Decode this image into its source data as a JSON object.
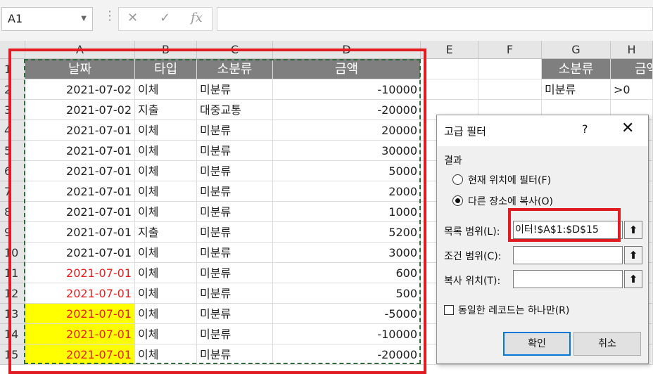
{
  "formula_bar": {
    "name_box": "A1",
    "cancel_icon": "✕",
    "enter_icon": "✓",
    "fx_label": "fx",
    "formula": ""
  },
  "columns": [
    "A",
    "B",
    "C",
    "D",
    "E",
    "F",
    "G",
    "H"
  ],
  "rows": [
    {
      "n": "1",
      "a": "날짜",
      "b": "타입",
      "c": "소분류",
      "d": "금액"
    },
    {
      "n": "2",
      "a": "2021-07-02",
      "b": "이체",
      "c": "미분류",
      "d": "-10000"
    },
    {
      "n": "3",
      "a": "2021-07-02",
      "b": "지출",
      "c": "대중교통",
      "d": "-20000"
    },
    {
      "n": "4",
      "a": "2021-07-01",
      "b": "이체",
      "c": "미분류",
      "d": "20000"
    },
    {
      "n": "5",
      "a": "2021-07-01",
      "b": "이체",
      "c": "미분류",
      "d": "30000"
    },
    {
      "n": "6",
      "a": "2021-07-01",
      "b": "이체",
      "c": "미분류",
      "d": "5000"
    },
    {
      "n": "7",
      "a": "2021-07-01",
      "b": "이체",
      "c": "미분류",
      "d": "2000"
    },
    {
      "n": "8",
      "a": "2021-07-01",
      "b": "이체",
      "c": "미분류",
      "d": "1000"
    },
    {
      "n": "9",
      "a": "2021-07-01",
      "b": "지출",
      "c": "미분류",
      "d": "5200"
    },
    {
      "n": "10",
      "a": "2021-07-01",
      "b": "이체",
      "c": "미분류",
      "d": "3000"
    },
    {
      "n": "11",
      "a": "2021-07-01",
      "b": "이체",
      "c": "미분류",
      "d": "600"
    },
    {
      "n": "12",
      "a": "2021-07-01",
      "b": "이체",
      "c": "미분류",
      "d": "500"
    },
    {
      "n": "13",
      "a": "2021-07-01",
      "b": "이체",
      "c": "미분류",
      "d": "-5000"
    },
    {
      "n": "14",
      "a": "2021-07-01",
      "b": "이체",
      "c": "미분류",
      "d": "-10000"
    },
    {
      "n": "15",
      "a": "2021-07-01",
      "b": "이체",
      "c": "미분류",
      "d": "-20000"
    }
  ],
  "criteria": {
    "g1": "소분류",
    "h1": "금액",
    "g2": "미분류",
    "h2": ">0"
  },
  "colors": {
    "header_fill": "#7f7f7f",
    "highlight_yellow": "#ffff00",
    "red_text": "#e81e1e",
    "annotation_red": "#e11b22"
  },
  "dialog": {
    "title": "고급 필터",
    "help": "?",
    "close": "✕",
    "result_group": "결과",
    "radio_filter_in_place": "현재 위치에 필터(F)",
    "radio_copy_to": "다른 장소에 복사(O)",
    "list_range_label": "목록 범위(L):",
    "list_range_value": "이터!$A$1:$D$15",
    "criteria_range_label": "조건 범위(C):",
    "criteria_range_value": "",
    "copy_to_label": "복사 위치(T):",
    "copy_to_value": "",
    "unique_label": "동일한 레코드는 하나만(R)",
    "ok": "확인",
    "cancel": "취소",
    "pick_icon": "⬆"
  }
}
